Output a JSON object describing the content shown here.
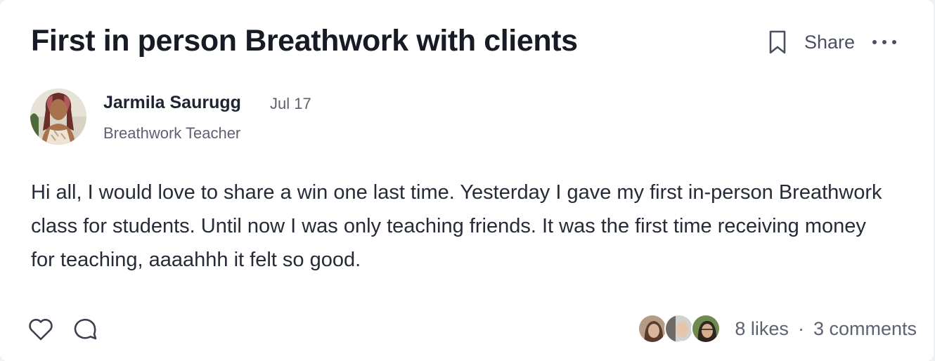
{
  "post": {
    "title": "First in person Breathwork with clients",
    "share_label": "Share",
    "author": {
      "name": "Jarmila Saurugg",
      "date": "Jul 17",
      "role": "Breathwork Teacher"
    },
    "body": "Hi all, I would love to share a win one last time. Yesterday I gave my first in-person Breathwork class for students. Until now I was only teaching friends. It was the first time receiving money for teaching, aaaahhh it felt so good."
  },
  "footer": {
    "likes": "8 likes",
    "separator": "·",
    "comments": "3 comments"
  },
  "icons": {
    "bookmark": "bookmark-icon",
    "more": "more-horizontal-icon",
    "like": "heart-icon",
    "comment": "comment-bubble-icon"
  },
  "colors": {
    "text_primary": "#1f2433",
    "text_secondary": "#5c6270",
    "card_background": "#ffffff"
  }
}
